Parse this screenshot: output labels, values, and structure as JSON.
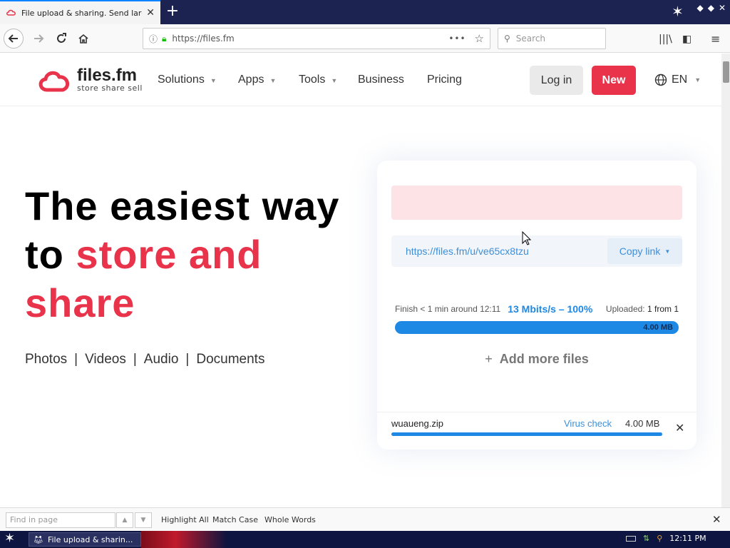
{
  "browser": {
    "tab": {
      "title": "File upload & sharing. Send large p",
      "close": "✕",
      "favicon": "files-fm-logo"
    },
    "new_tab": "+",
    "url": "https://files.fm",
    "search_placeholder": "Search",
    "find_bar": {
      "placeholder": "Find in page",
      "options": [
        "Highlight All",
        "Match Case",
        "Whole Words"
      ],
      "close": "✕"
    }
  },
  "site": {
    "logo": {
      "name": "files.fm",
      "tagline": "store  share  sell",
      "brand_color": "#e8334a"
    },
    "nav": [
      {
        "label": "Solutions",
        "dropdown": true
      },
      {
        "label": "Apps",
        "dropdown": true
      },
      {
        "label": "Tools",
        "dropdown": true
      },
      {
        "label": "Business",
        "dropdown": false
      },
      {
        "label": "Pricing",
        "dropdown": false
      }
    ],
    "login_label": "Log in",
    "new_label": "New",
    "language": "EN",
    "hero": {
      "line1": "The easiest way",
      "line2a": "to ",
      "line2b": "store and",
      "line3": "share"
    },
    "categories": [
      "Photos",
      "Videos",
      "Audio",
      "Documents"
    ],
    "category_separator": "|",
    "upload_card": {
      "link": "https://files.fm/u/ve65cx8tzu",
      "copy_label": "Copy link",
      "finish_label": "Finish",
      "finish_value": "< 1 min around 12:11",
      "speed": "13 Mbits/s – 100%",
      "uploaded_label": "Uploaded:",
      "uploaded_value": "1 from 1",
      "total_size": "4.00 MB",
      "progress": 1.0,
      "add_more_label": "Add more files",
      "file": {
        "name": "wuaueng.zip",
        "virus_check_label": "Virus check",
        "size": "4.00 MB",
        "progress": 1.0
      }
    }
  },
  "taskbar": {
    "app_title": "File upload & sharin...",
    "clock": "12:11 PM"
  }
}
